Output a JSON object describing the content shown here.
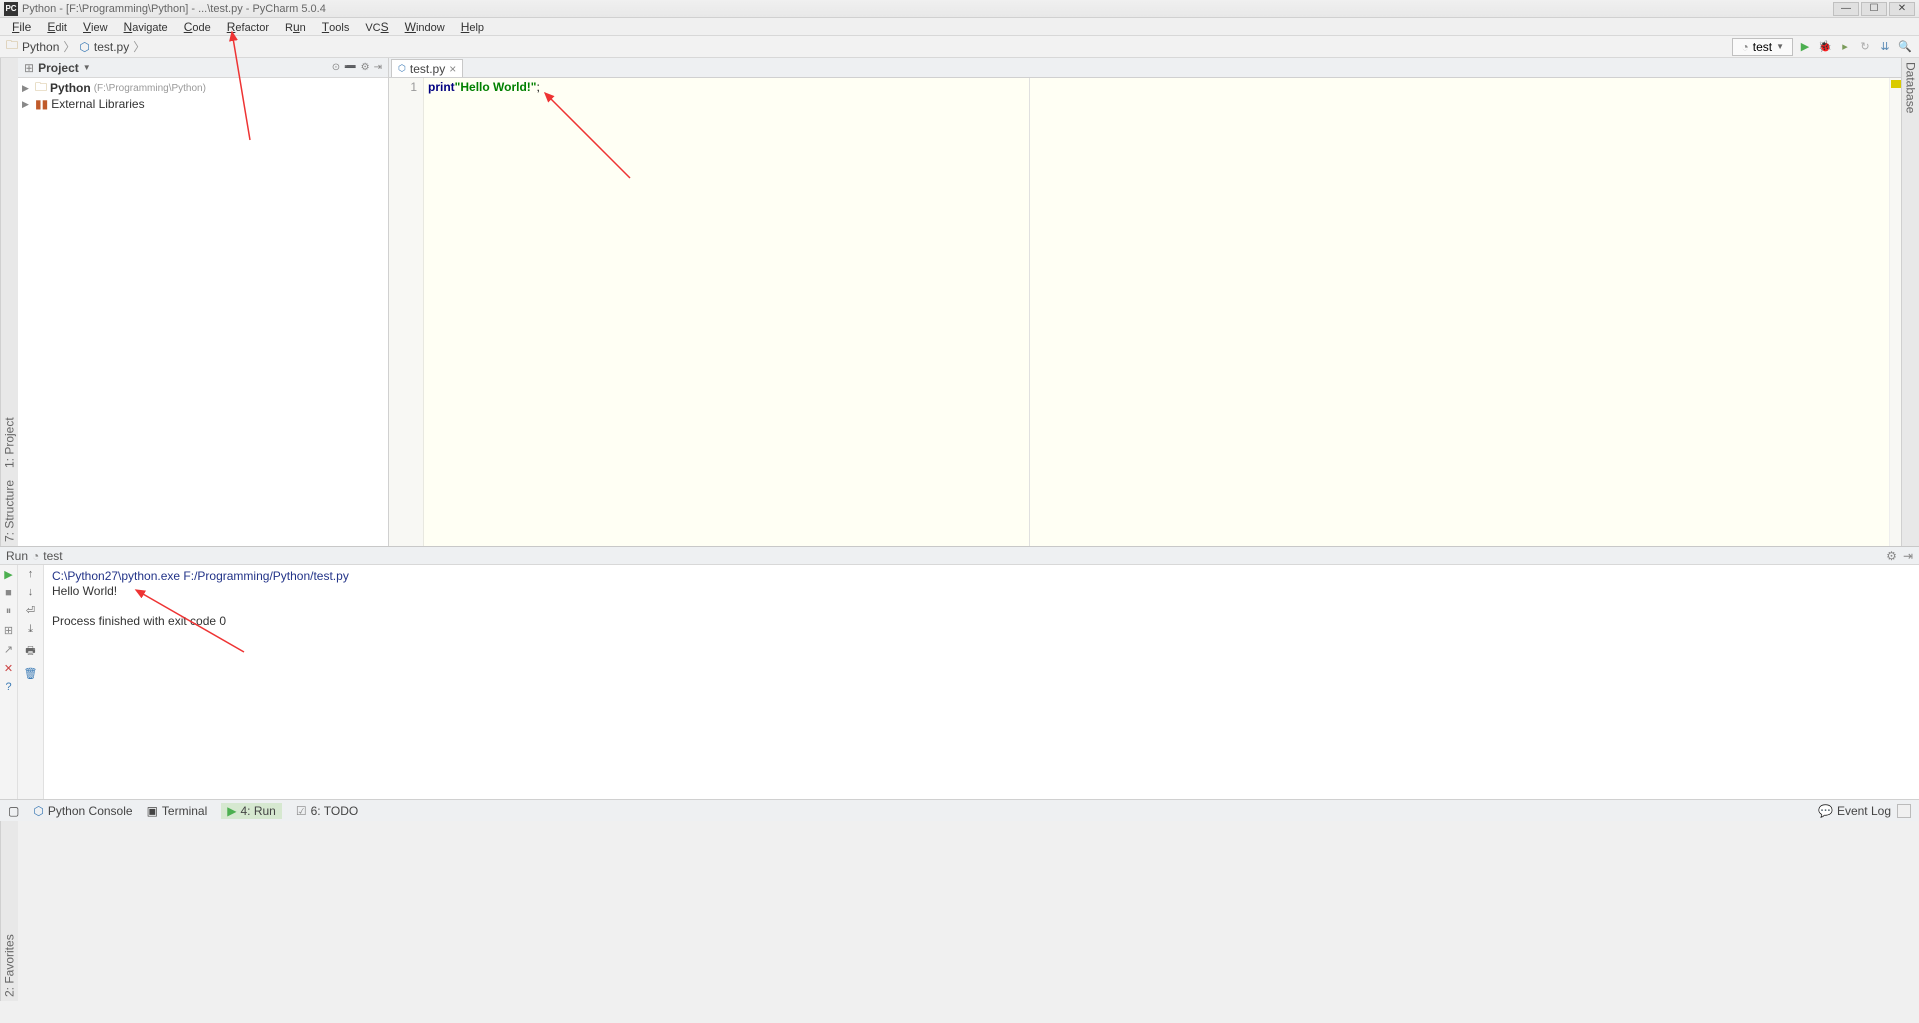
{
  "title_bar": {
    "app_badge": "PC",
    "title": "Python - [F:\\Programming\\Python] - ...\\test.py - PyCharm 5.0.4"
  },
  "menu": {
    "file": "File",
    "edit": "Edit",
    "view": "View",
    "navigate": "Navigate",
    "code": "Code",
    "refactor": "Refactor",
    "run": "Run",
    "tools": "Tools",
    "vcs": "VCS",
    "window": "Window",
    "help": "Help"
  },
  "breadcrumb": {
    "root": "Python",
    "file": "test.py"
  },
  "run_config": {
    "label": "test"
  },
  "left_stripes": {
    "project": "1: Project",
    "structure": "7: Structure"
  },
  "right_stripes": {
    "database": "Database"
  },
  "bottom_stripes": {
    "favorites": "2: Favorites"
  },
  "project_panel": {
    "title": "Project",
    "root_name": "Python",
    "root_path": "(F:\\Programming\\Python)",
    "external_libs": "External Libraries"
  },
  "editor": {
    "tab": "test.py",
    "line_no": "1",
    "code_kw": "print",
    "code_str": "\"Hello World!\"",
    "code_tail": ";"
  },
  "run_panel": {
    "title_prefix": "Run",
    "title_config": "test",
    "output_cmd": "C:\\Python27\\python.exe F:/Programming/Python/test.py",
    "output_line": "Hello World!",
    "output_finish": "Process finished with exit code 0"
  },
  "status_bar": {
    "python_console": "Python Console",
    "terminal": "Terminal",
    "run": "4: Run",
    "todo": "6: TODO",
    "event_log": "Event Log"
  }
}
